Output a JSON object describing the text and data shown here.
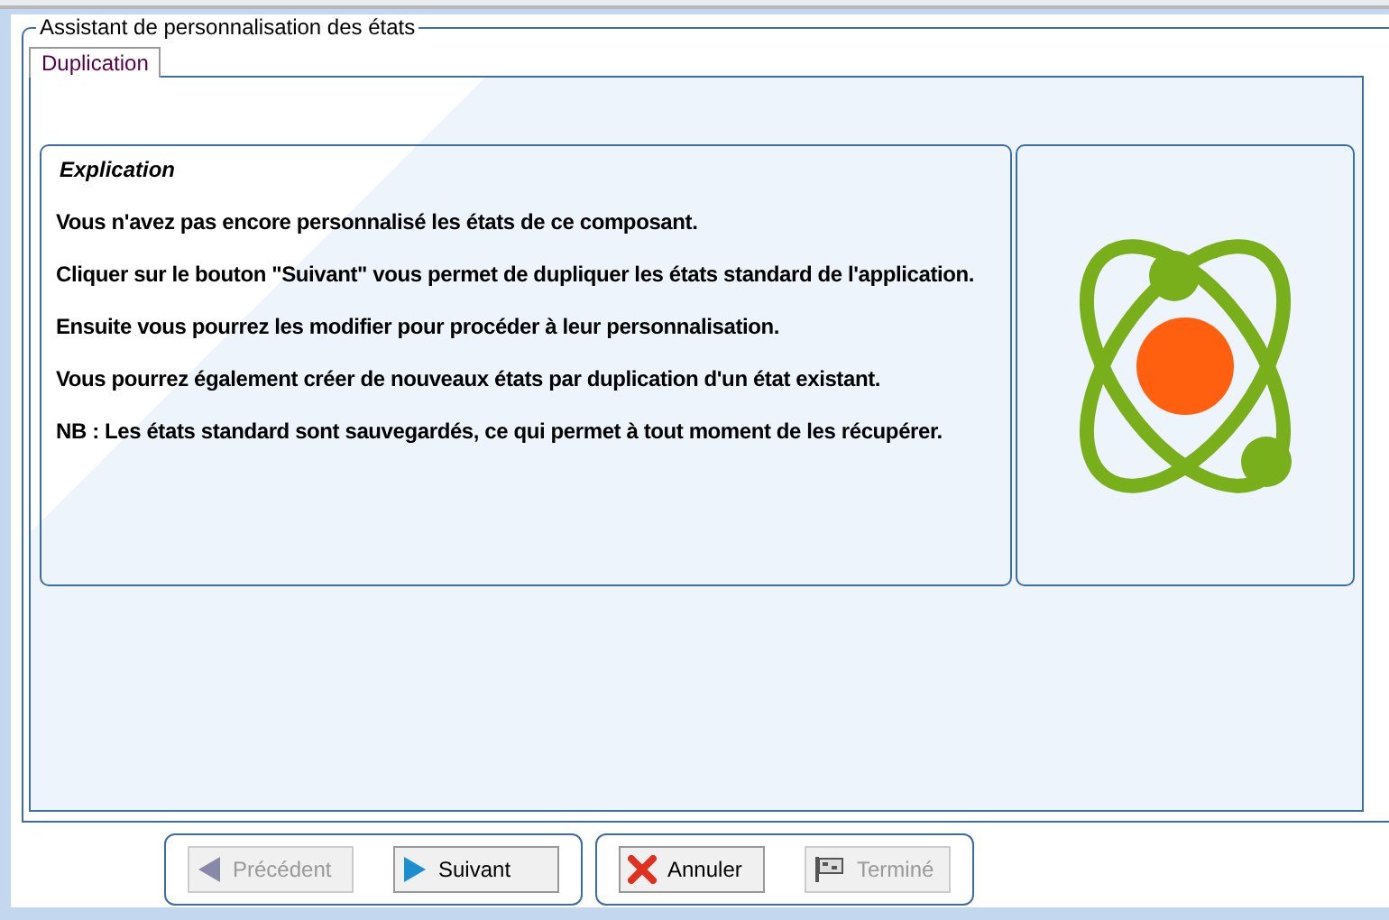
{
  "window": {
    "title": "Assistant de personnalisation des états"
  },
  "tabs": [
    {
      "label": "Duplication",
      "selected": true
    }
  ],
  "explanation": {
    "title": "Explication",
    "paragraphs": [
      "Vous n'avez pas encore personnalisé les états de ce composant.",
      "Cliquer sur le bouton \"Suivant\"  vous permet de dupliquer les états standard de l'application.",
      "Ensuite vous pourrez les modifier pour procéder à leur personnalisation.",
      "Vous pourrez également créer de nouveaux états par duplication d'un état existant.",
      "NB : Les états standard sont sauvegardés, ce qui permet à tout moment de les récupérer."
    ]
  },
  "button_groups": [
    [
      {
        "label": "Précédent",
        "kind": "previous",
        "disabled": true
      },
      {
        "label": "Suivant",
        "kind": "next",
        "disabled": false
      }
    ],
    [
      {
        "label": "Annuler",
        "kind": "cancel",
        "disabled": false
      },
      {
        "label": "Terminé",
        "kind": "finish",
        "disabled": true
      }
    ]
  ]
}
